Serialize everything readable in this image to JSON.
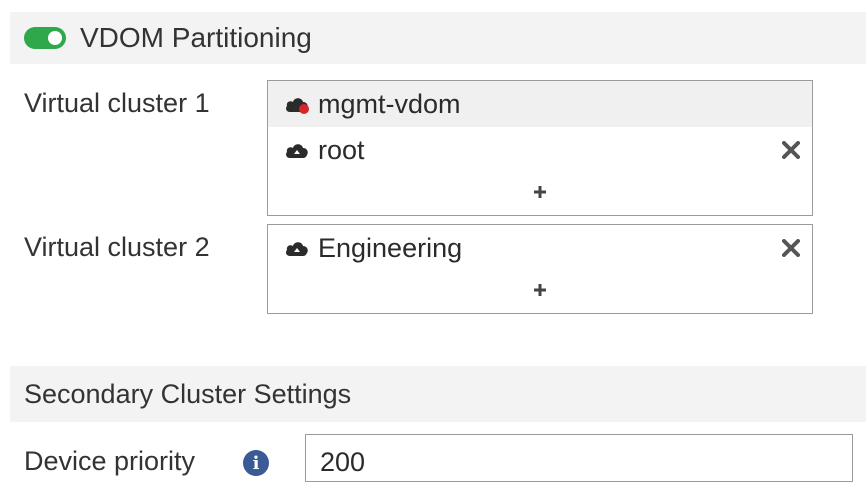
{
  "vdom_partitioning": {
    "enabled": true,
    "toggle_color": "#2ea84a",
    "title": "VDOM Partitioning"
  },
  "clusters": [
    {
      "label": "Virtual cluster 1",
      "vdoms": [
        {
          "name": "mgmt-vdom",
          "icon": "cloud-alert-icon",
          "selected": true,
          "removable": false
        },
        {
          "name": "root",
          "icon": "cloud-icon",
          "selected": false,
          "removable": true
        }
      ],
      "add_label": "+"
    },
    {
      "label": "Virtual cluster 2",
      "vdoms": [
        {
          "name": "Engineering",
          "icon": "cloud-icon",
          "selected": false,
          "removable": true
        }
      ],
      "add_label": "+"
    }
  ],
  "secondary": {
    "title": "Secondary Cluster Settings",
    "device_priority_label": "Device priority",
    "device_priority_value": "200",
    "info_icon": "info-icon"
  }
}
